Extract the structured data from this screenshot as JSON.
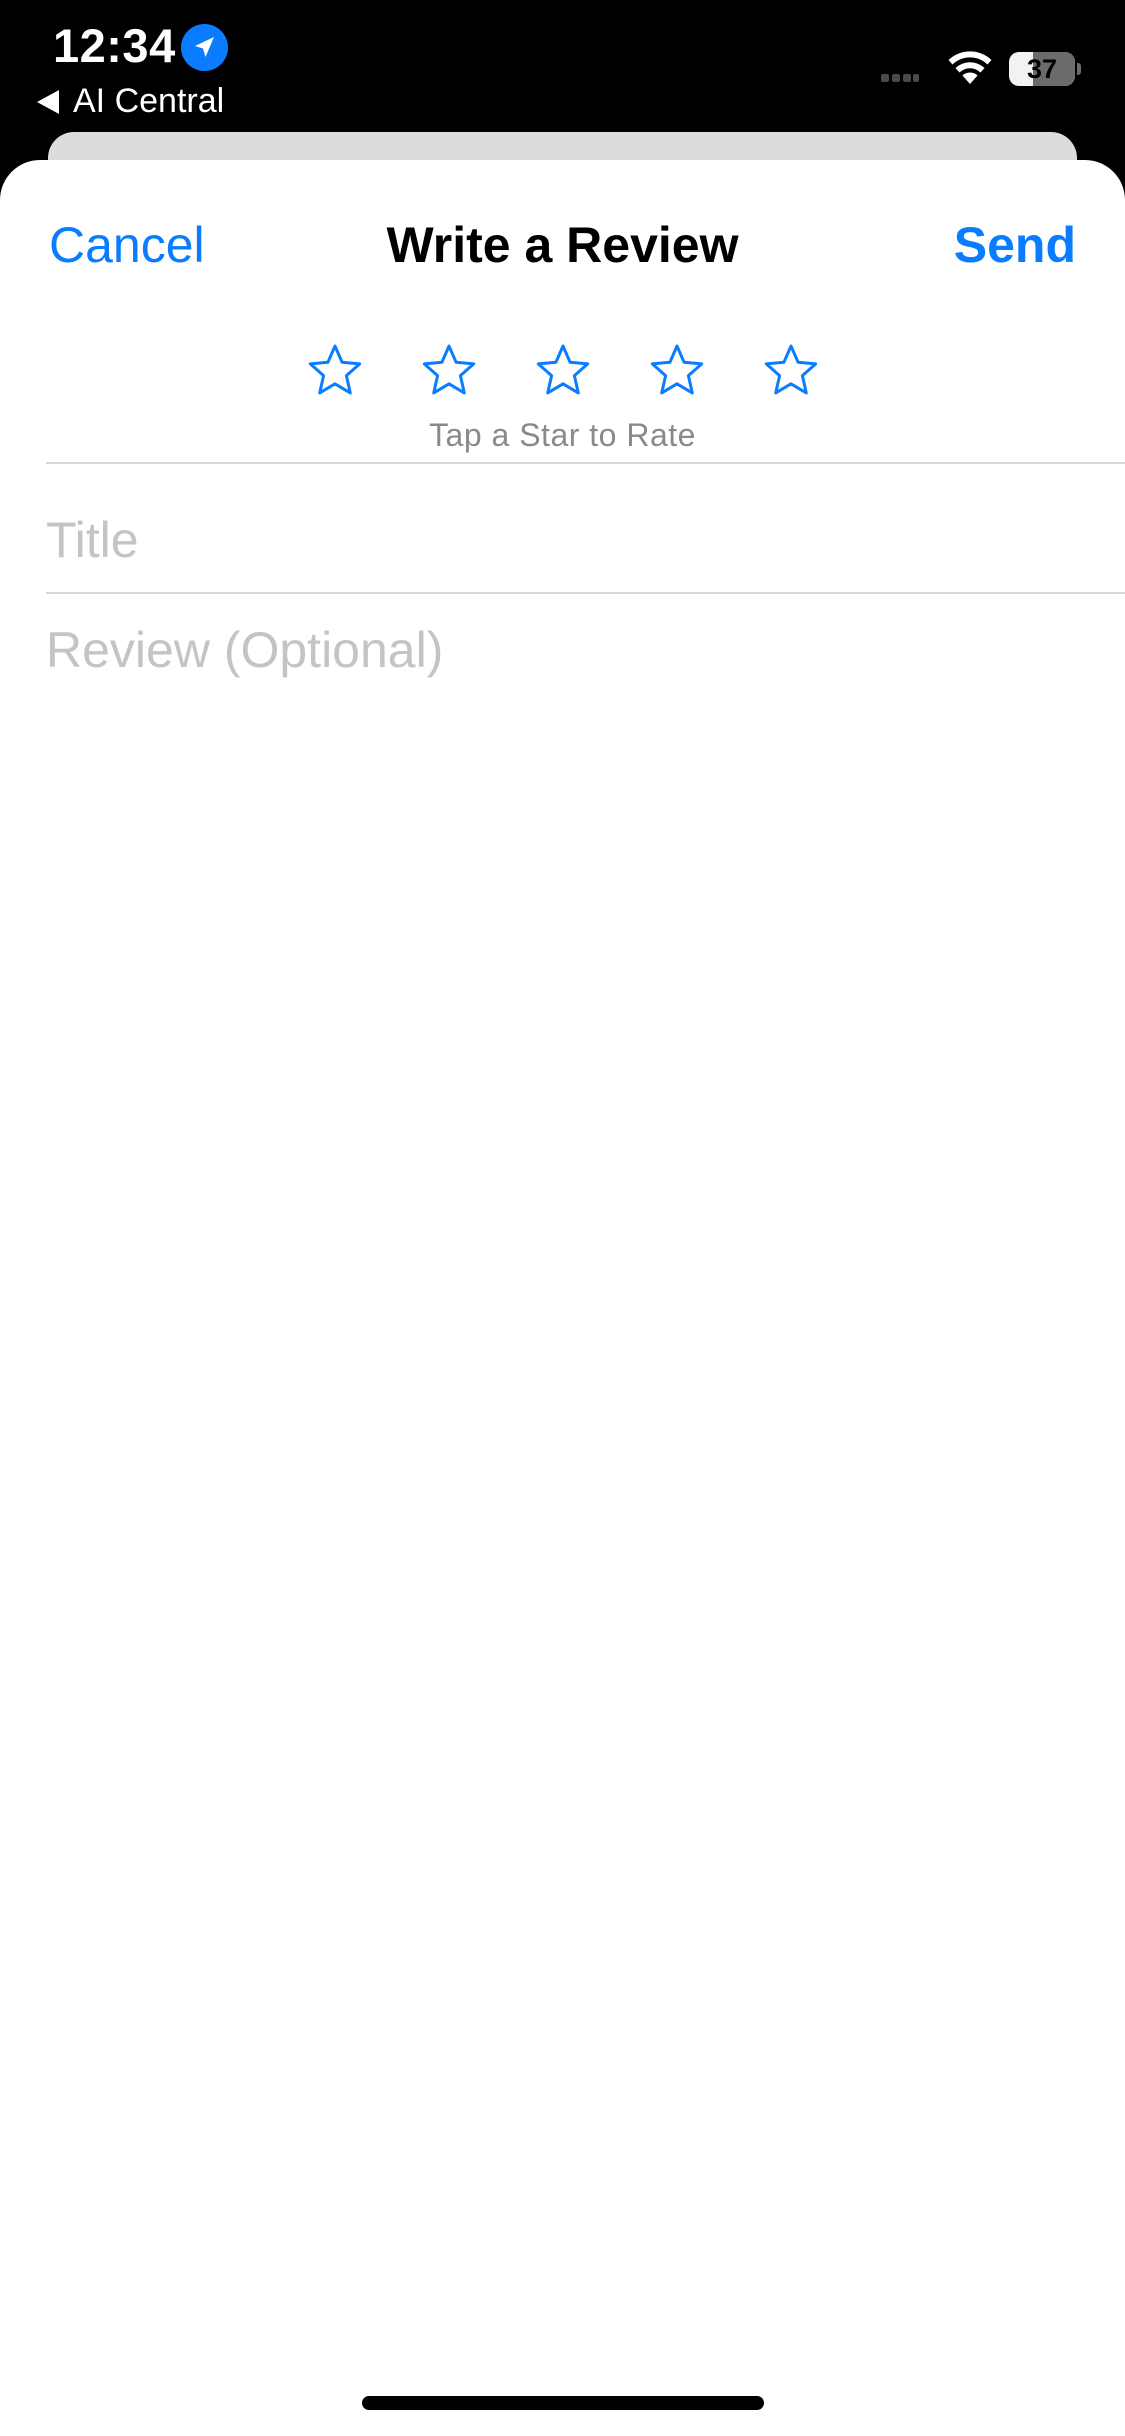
{
  "status_bar": {
    "time": "12:34",
    "back_app_label": "AI Central",
    "battery_level": "37",
    "battery_fraction": 0.37,
    "location_icon": "location-arrow-icon",
    "wifi_icon": "wifi-icon",
    "signal_icon": "cellular-signal-icon"
  },
  "nav": {
    "cancel_label": "Cancel",
    "title": "Write a Review",
    "send_label": "Send"
  },
  "rating": {
    "hint": "Tap a Star to Rate",
    "selected_stars": 0,
    "max_stars": 5,
    "star_icon": "star-outline-icon"
  },
  "form": {
    "title_placeholder": "Title",
    "title_value": "",
    "review_placeholder": "Review (Optional)",
    "review_value": ""
  },
  "colors": {
    "accent": "#0a7cff",
    "hint_text": "#8a8a8e",
    "placeholder": "#c4c4c6",
    "divider": "#d9d9dc"
  }
}
